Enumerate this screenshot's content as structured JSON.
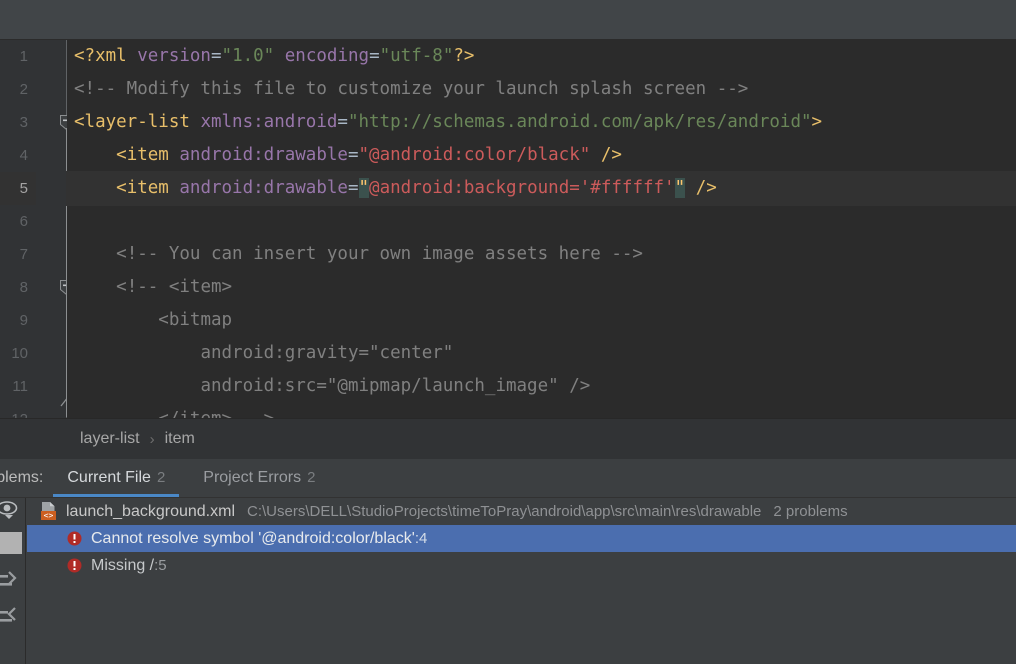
{
  "editor": {
    "lines": [
      {
        "num": "1",
        "tokens": [
          {
            "t": "<?xml ",
            "c": "tag"
          },
          {
            "t": "version",
            "c": "attr"
          },
          {
            "t": "=",
            "c": "punct"
          },
          {
            "t": "\"1.0\"",
            "c": "str"
          },
          {
            "t": " ",
            "c": "punct"
          },
          {
            "t": "encoding",
            "c": "attr"
          },
          {
            "t": "=",
            "c": "punct"
          },
          {
            "t": "\"utf-8\"",
            "c": "str"
          },
          {
            "t": "?>",
            "c": "tag"
          }
        ]
      },
      {
        "num": "2",
        "tokens": [
          {
            "t": "<!-- Modify this file to customize your launch splash screen -->",
            "c": "comment"
          }
        ]
      },
      {
        "num": "3",
        "fold": true,
        "tokens": [
          {
            "t": "<layer-list ",
            "c": "tag"
          },
          {
            "t": "xmlns:android",
            "c": "attr"
          },
          {
            "t": "=",
            "c": "punct"
          },
          {
            "t": "\"http://schemas.android.com/apk/res/android\"",
            "c": "str"
          },
          {
            "t": ">",
            "c": "tag"
          }
        ]
      },
      {
        "num": "4",
        "tokens": [
          {
            "t": "    ",
            "c": "punct"
          },
          {
            "t": "<item ",
            "c": "tag"
          },
          {
            "t": "android:drawable",
            "c": "attr"
          },
          {
            "t": "=",
            "c": "punct"
          },
          {
            "t": "\"@android:color/black\"",
            "c": "strerr"
          },
          {
            "t": " ",
            "c": "punct"
          },
          {
            "t": "/>",
            "c": "bracket"
          }
        ]
      },
      {
        "num": "5",
        "highlight": true,
        "tokens": [
          {
            "t": "    ",
            "c": "punct"
          },
          {
            "t": "<item ",
            "c": "tag"
          },
          {
            "t": "android:drawable",
            "c": "attr"
          },
          {
            "t": "=",
            "c": "punct"
          },
          {
            "t": "\"",
            "c": "match"
          },
          {
            "t": "@android:background='#ffffff'",
            "c": "strerr"
          },
          {
            "t": "\"",
            "c": "match"
          },
          {
            "t": " ",
            "c": "punct"
          },
          {
            "t": "/>",
            "c": "bracket"
          }
        ]
      },
      {
        "num": "6",
        "tokens": []
      },
      {
        "num": "7",
        "tokens": [
          {
            "t": "    ",
            "c": "punct"
          },
          {
            "t": "<!-- You can insert your own image assets here -->",
            "c": "comment"
          }
        ]
      },
      {
        "num": "8",
        "fold": true,
        "tokens": [
          {
            "t": "    ",
            "c": "punct"
          },
          {
            "t": "<!-- <item>",
            "c": "comment"
          }
        ]
      },
      {
        "num": "9",
        "tokens": [
          {
            "t": "        ",
            "c": "punct"
          },
          {
            "t": "<bitmap",
            "c": "comment"
          }
        ]
      },
      {
        "num": "10",
        "tokens": [
          {
            "t": "            ",
            "c": "punct"
          },
          {
            "t": "android:gravity=\"center\"",
            "c": "comment"
          }
        ]
      },
      {
        "num": "11",
        "tokens": [
          {
            "t": "            ",
            "c": "punct"
          },
          {
            "t": "android:src=\"@mipmap/launch_image\" />",
            "c": "comment"
          }
        ]
      },
      {
        "num": "12",
        "clipped": true,
        "tokens": [
          {
            "t": "        ",
            "c": "punct"
          },
          {
            "t": "</item> -->",
            "c": "comment"
          }
        ]
      }
    ]
  },
  "breadcrumb": {
    "items": [
      "layer-list",
      "item"
    ],
    "separator": "›"
  },
  "problems": {
    "title": "roblems:",
    "tabs": [
      {
        "label": "Current File",
        "count": "2",
        "active": true
      },
      {
        "label": "Project Errors",
        "count": "2",
        "active": false
      }
    ],
    "file": {
      "name": "launch_background.xml",
      "path": "C:\\Users\\DELL\\StudioProjects\\timeToPray\\android\\app\\src\\main\\res\\drawable",
      "count": "2 problems",
      "icon": "xml-file-icon"
    },
    "issues": [
      {
        "text": "Cannot resolve symbol '@android:color/black'",
        "line": ":4",
        "selected": true,
        "icon": "error-icon"
      },
      {
        "text": "Missing /",
        "line": ":5",
        "selected": false,
        "icon": "error-icon"
      }
    ],
    "side_buttons": [
      {
        "name": "inspection-severity-icon"
      },
      {
        "name": "selected-toggle-button"
      },
      {
        "name": "expand-all-icon"
      },
      {
        "name": "collapse-all-icon"
      }
    ]
  },
  "colors": {
    "editor_bg": "#2b2b2b",
    "gutter_bg": "#313335",
    "panel_bg": "#3c3f41",
    "selection_blue": "#4b6eaf",
    "tab_underline": "#4a88c7",
    "error_red": "#c0392b",
    "string_green": "#6a8759",
    "tag_yellow": "#e8bf6a",
    "attr_purple": "#9876aa",
    "comment_gray": "#808080",
    "error_string": "#cc5b5b",
    "match_highlight": "#3b514d"
  }
}
